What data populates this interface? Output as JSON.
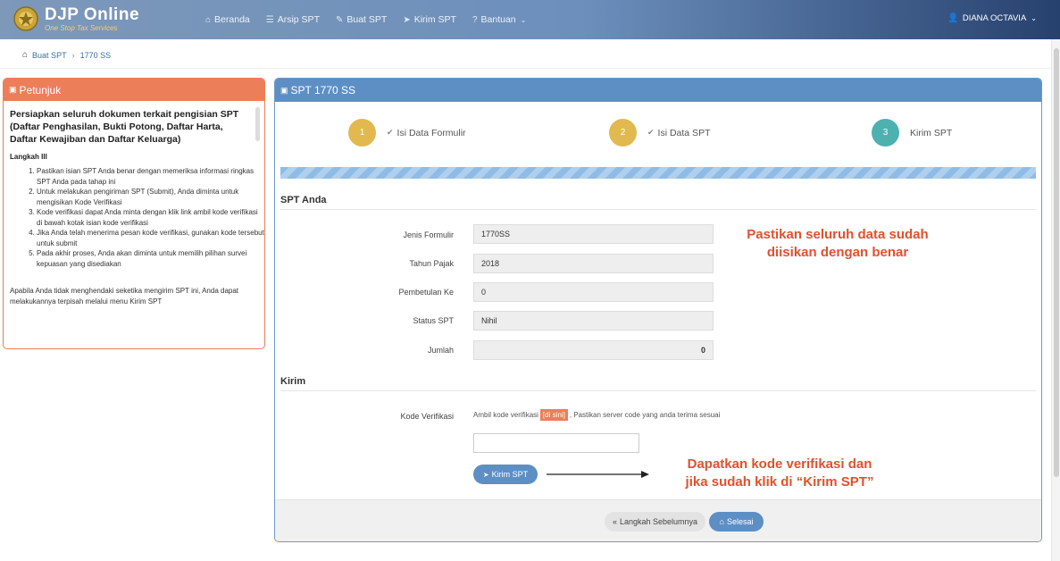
{
  "app": {
    "title": "DJP Online",
    "subtitle": "One Stop Tax Services"
  },
  "nav": {
    "items": [
      {
        "label": "Beranda",
        "icon": "home-icon"
      },
      {
        "label": "Arsip SPT",
        "icon": "list-icon"
      },
      {
        "label": "Buat SPT",
        "icon": "edit-icon"
      },
      {
        "label": "Kirim SPT",
        "icon": "send-icon"
      },
      {
        "label": "Bantuan",
        "icon": "help-icon"
      }
    ],
    "user": "DIANA OCTAVIA"
  },
  "breadcrumb": {
    "items": [
      "Buat SPT",
      "1770 SS"
    ]
  },
  "petunjuk": {
    "title": "Petunjuk",
    "intro": "Persiapkan seluruh dokumen terkait pengisian SPT (Daftar Penghasilan, Bukti Potong, Daftar Harta, Daftar Kewajiban dan Daftar Keluarga)",
    "step_title": "Langkah III",
    "steps": [
      "Pastikan isian SPT Anda benar dengan memeriksa informasi ringkas SPT Anda pada tahap ini",
      "Untuk melakukan pengiriman SPT (Submit), Anda diminta untuk mengisikan Kode Verifikasi",
      "Kode verifikasi dapat Anda minta dengan klik link ambil kode verifikasi di bawah kotak isian kode verifikasi",
      "Jika Anda telah menerima pesan kode verifikasi, gunakan kode tersebut untuk submit",
      "Pada akhir proses, Anda akan diminta untuk memilih pilihan survei kepuasan yang disediakan"
    ],
    "note": "Apabila Anda tidak menghendaki seketika mengirim SPT ini, Anda dapat melakukannya terpisah melalui menu Kirim SPT"
  },
  "main": {
    "title": "SPT 1770 SS",
    "wizard": [
      {
        "num": "1",
        "label": "Isi Data Formulir",
        "done": true,
        "color": "#e2b94f"
      },
      {
        "num": "2",
        "label": "Isi Data SPT",
        "done": true,
        "color": "#e2b94f"
      },
      {
        "num": "3",
        "label": "Kirim SPT",
        "done": false,
        "color": "#4fb0b0"
      }
    ],
    "progress_percent": 100,
    "spt_section": "SPT Anda",
    "fields": [
      {
        "label": "Jenis Formulir",
        "value": "1770SS"
      },
      {
        "label": "Tahun Pajak",
        "value": "2018"
      },
      {
        "label": "Pembetulan Ke",
        "value": "0"
      },
      {
        "label": "Status SPT",
        "value": "Nihil"
      },
      {
        "label": "Jumlah",
        "value": "0"
      }
    ],
    "annotation_top": [
      "Pastikan seluruh data sudah",
      "diisikan dengan benar"
    ],
    "kirim_section": "Kirim",
    "kode_label": "Kode Verifikasi",
    "kode_hint_before": "Ambil kode verifikasi",
    "kode_link": "[di sini]",
    "kode_hint_after": ", Pastikan server code yang anda terima sesuai",
    "kode_value": "",
    "kirim_button": "Kirim SPT",
    "annotation_bottom": [
      "Dapatkan kode verifikasi dan",
      "jika sudah klik di “Kirim SPT”"
    ],
    "prev_button": "Langkah Sebelumnya",
    "done_button": "Selesai"
  },
  "colors": {
    "accent_orange": "#ec7e59",
    "accent_blue": "#5d8fc5",
    "annotation_red": "#e2502e"
  }
}
